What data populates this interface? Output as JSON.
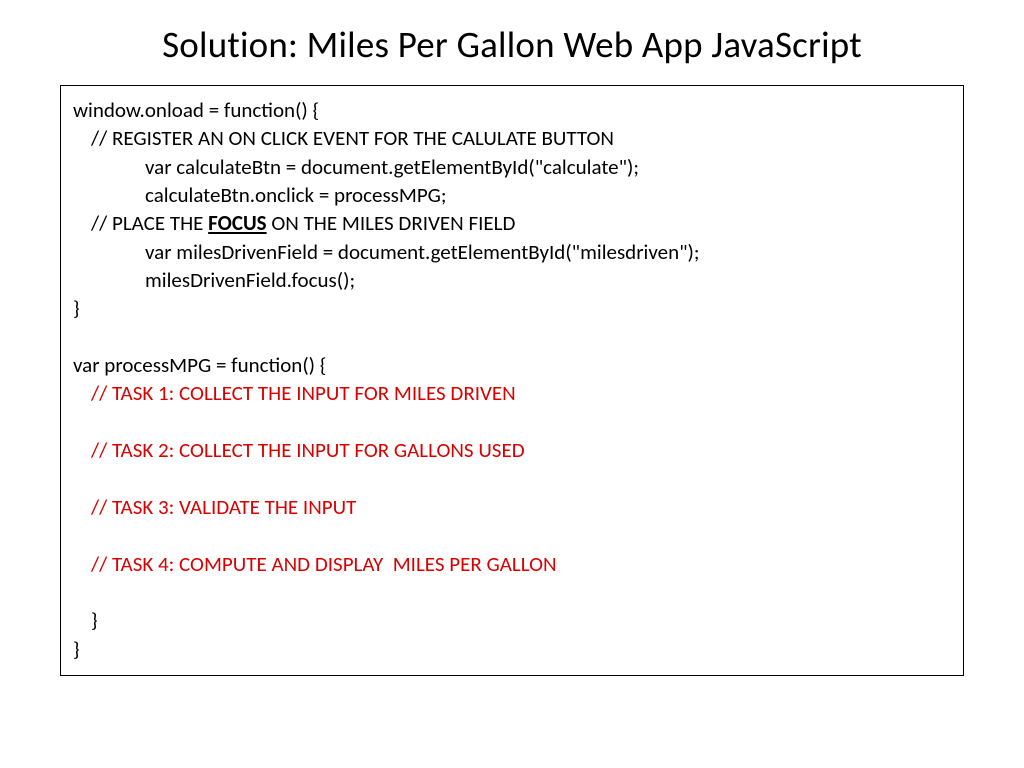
{
  "title": "Solution: Miles Per Gallon Web App JavaScript",
  "code": {
    "l1": "window.onload = function() {",
    "l2": "// REGISTER AN ON CLICK EVENT FOR THE CALULATE BUTTON",
    "l3": "var calculateBtn = document.getElementById(\"calculate\");",
    "l4": "calculateBtn.onclick = processMPG;",
    "l5a": "// PLACE THE ",
    "l5b": "FOCUS",
    "l5c": " ON THE MILES DRIVEN FIELD",
    "l6": "var milesDrivenField = document.getElementById(\"milesdriven\");",
    "l7": "milesDrivenField.focus();",
    "l8": "}",
    "l9": "var processMPG = function() {",
    "t1": "// TASK 1: COLLECT THE INPUT FOR MILES DRIVEN",
    "t2": "// TASK 2: COLLECT THE INPUT FOR GALLONS USED",
    "t3": "// TASK 3: VALIDATE THE INPUT",
    "t4": "// TASK 4: COMPUTE AND DISPLAY  MILES PER GALLON",
    "close1": "}",
    "close2": "}"
  }
}
